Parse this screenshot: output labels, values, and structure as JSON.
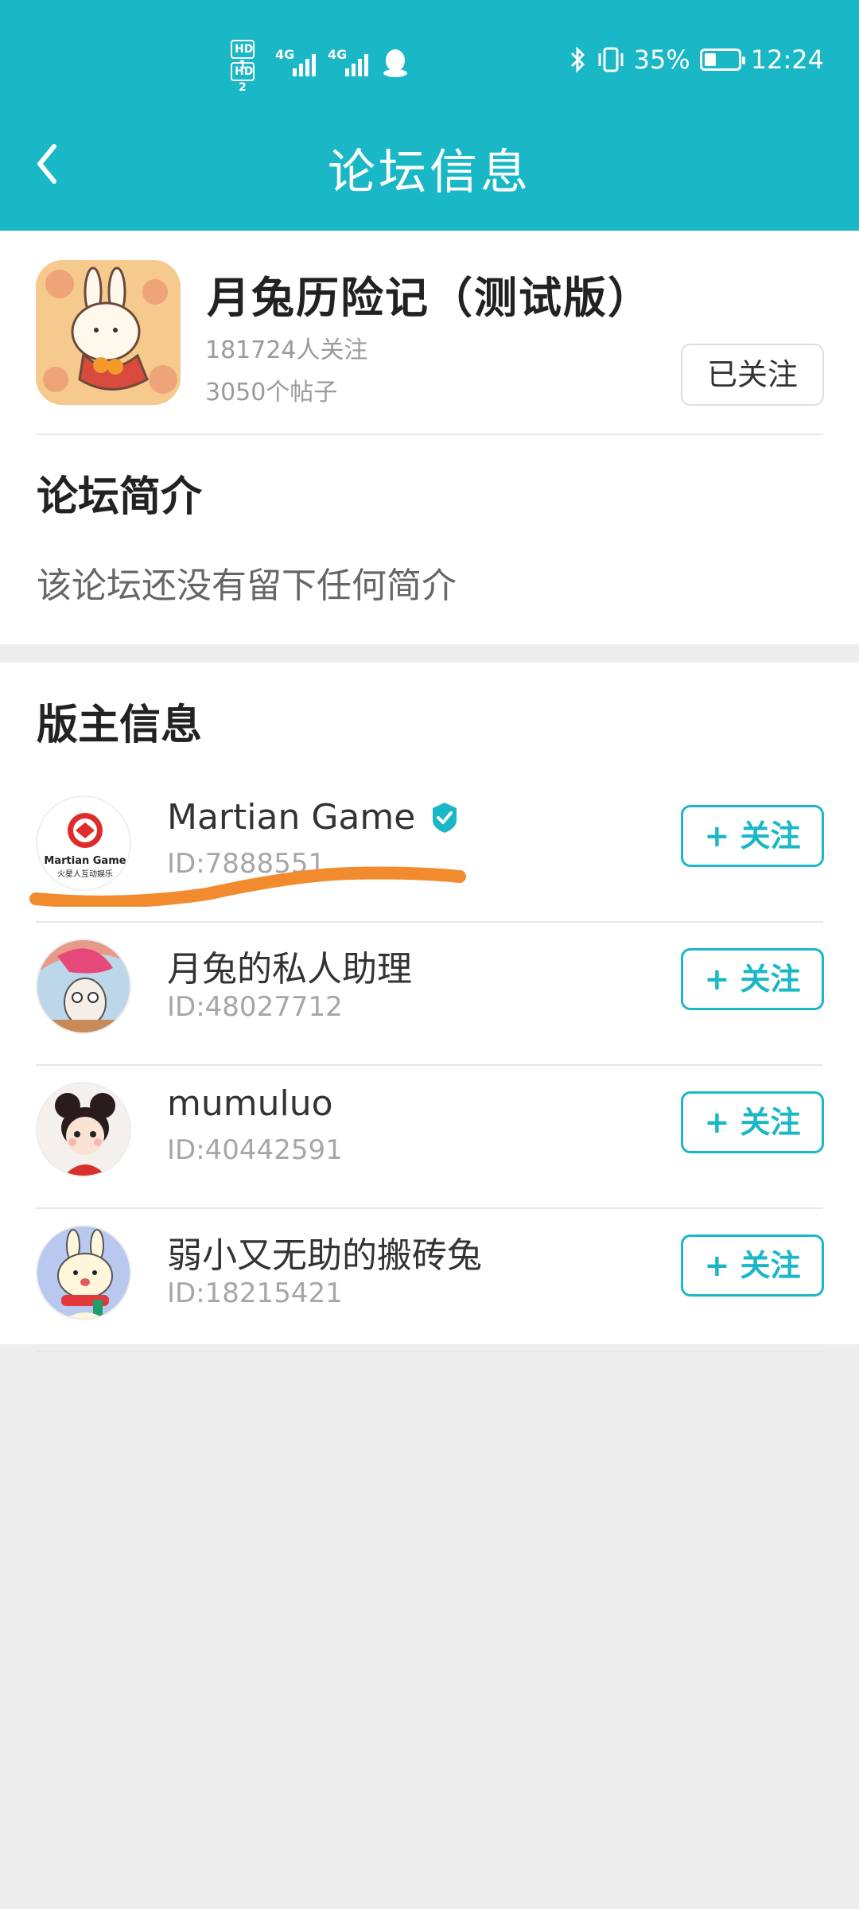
{
  "status_bar": {
    "hd1": "HD 1",
    "hd2": "HD 2",
    "net1": "4G",
    "net2": "4G",
    "battery": "35%",
    "battery_level": 0.35,
    "time": "12:24"
  },
  "header": {
    "title": "论坛信息",
    "bg_color": "#1ab7c6"
  },
  "forum": {
    "name": "月兔历险记（测试版）",
    "followers": "181724人关注",
    "posts": "3050个帖子",
    "follow_state_label": "已关注",
    "intro_title": "论坛简介",
    "intro_text": "该论坛还没有留下任何简介"
  },
  "moderators": {
    "title": "版主信息",
    "follow_label": "+ 关注",
    "items": [
      {
        "name": "Martian Game",
        "id": "ID:7888551",
        "verified": true,
        "logo_text": "Martian Game",
        "logo_sub": "火星人互动娱乐"
      },
      {
        "name": "月兔的私人助理",
        "id": "ID:48027712",
        "verified": false
      },
      {
        "name": "mumuluo",
        "id": "ID:40442591",
        "verified": false
      },
      {
        "name": "弱小又无助的搬砖兔",
        "id": "ID:18215421",
        "verified": false
      }
    ]
  }
}
